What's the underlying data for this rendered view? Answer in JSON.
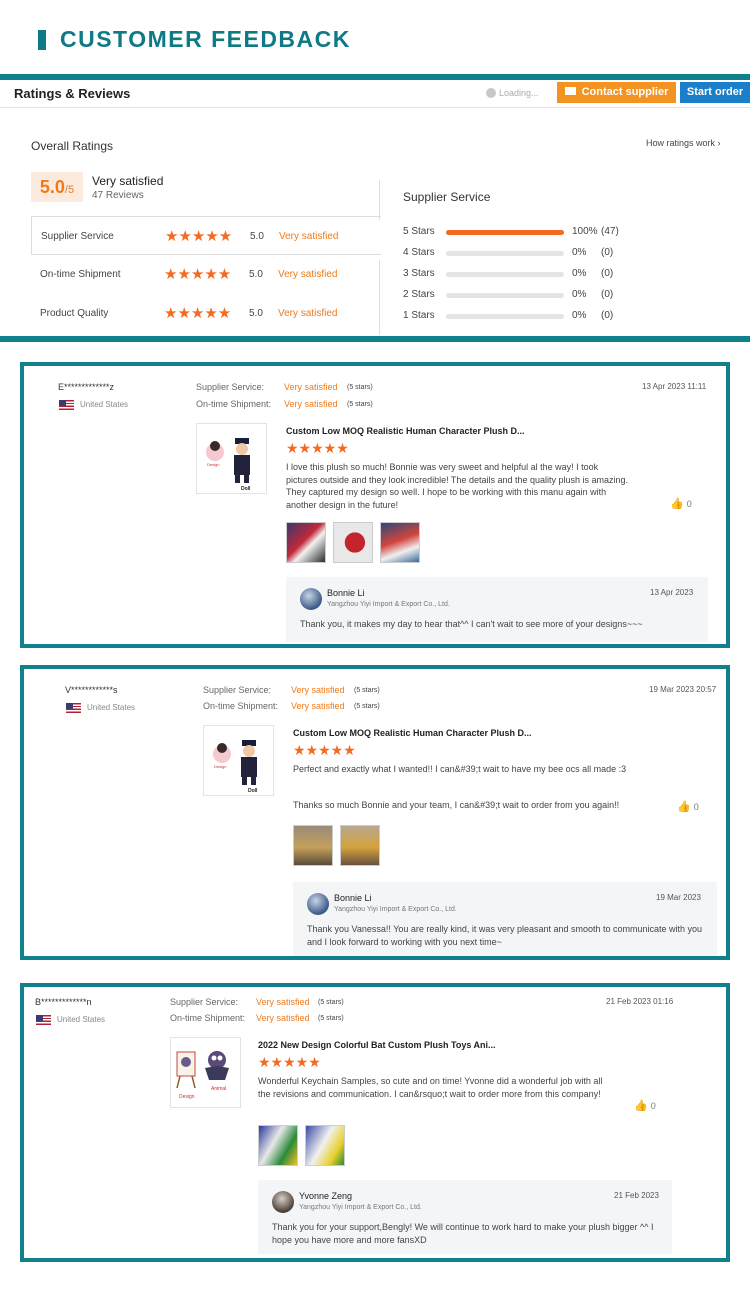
{
  "banner": {
    "title": "CUSTOMER FEEDBACK"
  },
  "ratings": {
    "title": "Ratings & Reviews",
    "loading": "Loading...",
    "contact_label": "Contact supplier",
    "start_label": "Start order",
    "overall_label": "Overall Ratings",
    "how_label": "How ratings work",
    "score": "5.0",
    "score_max": "/5",
    "score_text": "Very satisfied",
    "reviews": "47 Reviews",
    "criteria": [
      {
        "label": "Supplier Service",
        "stars": "★★★★★",
        "score": "5.0",
        "text": "Very satisfied"
      },
      {
        "label": "On-time Shipment",
        "stars": "★★★★★",
        "score": "5.0",
        "text": "Very satisfied"
      },
      {
        "label": "Product Quality",
        "stars": "★★★★★",
        "score": "5.0",
        "text": "Very satisfied"
      }
    ],
    "service_title": "Supplier Service",
    "distribution": [
      {
        "label": "5  Stars",
        "fraction": 1.0,
        "pct": "100%",
        "count": "(47)"
      },
      {
        "label": "4  Stars",
        "fraction": 0,
        "pct": "0%",
        "count": "(0)"
      },
      {
        "label": "3  Stars",
        "fraction": 0,
        "pct": "0%",
        "count": "(0)"
      },
      {
        "label": "2  Stars",
        "fraction": 0,
        "pct": "0%",
        "count": "(0)"
      },
      {
        "label": "1  Stars",
        "fraction": 0,
        "pct": "0%",
        "count": "(0)"
      }
    ]
  },
  "reviews": [
    {
      "user": "E*************z",
      "country": "United States",
      "service_label": "Supplier Service:",
      "service_value": "Very satisfied",
      "service_stars": "(5 stars)",
      "shipment_label": "On-time Shipment:",
      "shipment_value": "Very satisfied",
      "shipment_stars": "(5 stars)",
      "date": "13 Apr 2023 11:11",
      "product": "Custom Low MOQ Realistic Human Character Plush D...",
      "stars": "★★★★★",
      "body": "I love this plush so much! Bonnie was very sweet and helpful al the way! I took pictures outside and they look incredible! The details and the quality plush is amazing. They captured my design so well. I hope to be working with this manu again with another design in the future!",
      "likes": "0",
      "reply_name": "Bonnie Li",
      "reply_company": "Yangzhou Yiyi Import & Export Co., Ltd.",
      "reply_date": "13 Apr 2023",
      "reply_text": "Thank you, it makes my day to hear that^^ I can't wait to see more of your designs~~~"
    },
    {
      "user": "V************s",
      "country": "United States",
      "service_label": "Supplier Service:",
      "service_value": "Very satisfied",
      "service_stars": "(5 stars)",
      "shipment_label": "On-time Shipment:",
      "shipment_value": "Very satisfied",
      "shipment_stars": "(5 stars)",
      "date": "19 Mar 2023 20:57",
      "product": "Custom Low MOQ Realistic Human Character Plush D...",
      "stars": "★★★★★",
      "body": "Perfect and exactly what I wanted!! I can&#39;t wait to have my bee ocs all made :3",
      "body2": "Thanks so much Bonnie and your team, I can&#39;t wait to order from you again!!",
      "likes": "0",
      "reply_name": "Bonnie Li",
      "reply_company": "Yangzhou Yiyi Import & Export Co., Ltd.",
      "reply_date": "19 Mar 2023",
      "reply_text": "Thank you Vanessa!! You are really kind, it was very pleasant and smooth to communicate with you and I look forward to working with you next time~"
    },
    {
      "user": "B*************n",
      "country": "United States",
      "service_label": "Supplier Service:",
      "service_value": "Very satisfied",
      "service_stars": "(5 stars)",
      "shipment_label": "On-time Shipment:",
      "shipment_value": "Very satisfied",
      "shipment_stars": "(5 stars)",
      "date": "21 Feb 2023 01:16",
      "product": "2022 New Design Colorful Bat Custom Plush Toys Ani...",
      "stars": "★★★★★",
      "body": "Wonderful Keychain Samples, so cute and on time! Yvonne did a wonderful job with all the revisions and communication. I can&rsquo;t wait to order more from this company!",
      "likes": "0",
      "reply_name": "Yvonne Zeng",
      "reply_company": "Yangzhou Yiyi Import & Export Co., Ltd.",
      "reply_date": "21 Feb 2023",
      "reply_text": "Thank you for your support,Bengly! We will continue to work hard to make your plush bigger ^^ I hope you have more and more fansXD"
    }
  ]
}
